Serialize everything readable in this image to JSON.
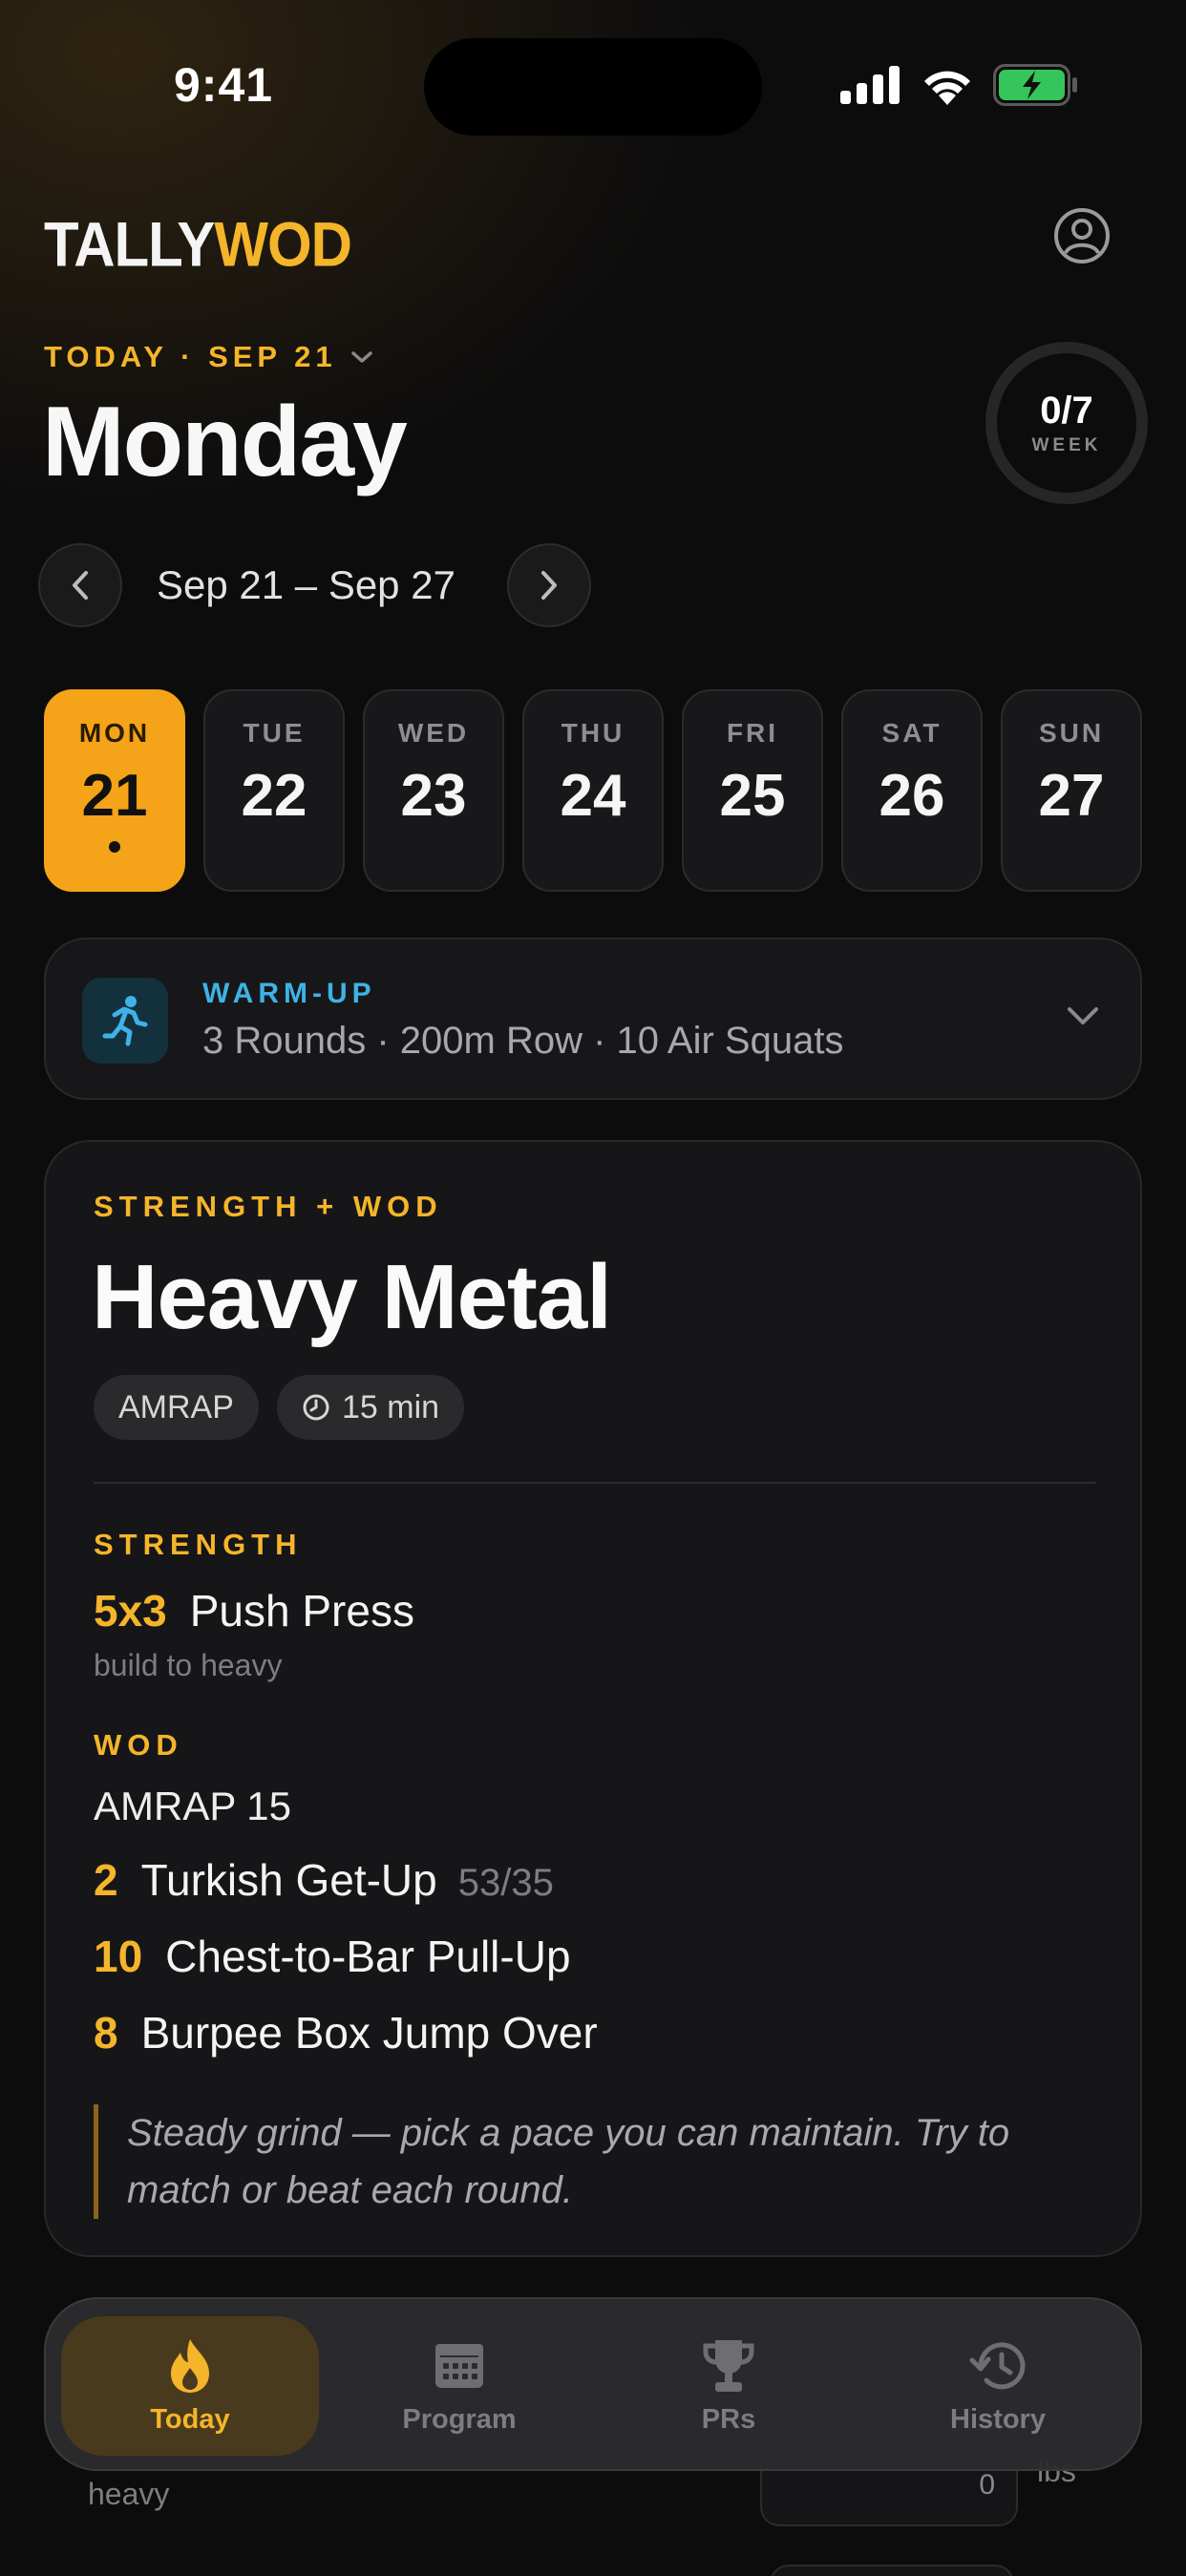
{
  "status_bar": {
    "time": "9:41"
  },
  "app": {
    "logo_part1": "TALLY",
    "logo_part2": "WOD"
  },
  "header": {
    "date_label": "TODAY · SEP 21",
    "day_title": "Monday",
    "week_progress": {
      "count": "0/7",
      "label": "WEEK",
      "completed": 0,
      "total": 7
    },
    "week_range": "Sep 21 – Sep 27"
  },
  "days": [
    {
      "name": "MON",
      "date": "21",
      "active": true,
      "has_workout": true
    },
    {
      "name": "TUE",
      "date": "22",
      "active": false
    },
    {
      "name": "WED",
      "date": "23",
      "active": false
    },
    {
      "name": "THU",
      "date": "24",
      "active": false
    },
    {
      "name": "FRI",
      "date": "25",
      "active": false
    },
    {
      "name": "SAT",
      "date": "26",
      "active": false
    },
    {
      "name": "SUN",
      "date": "27",
      "active": false
    }
  ],
  "warmup": {
    "tag": "WARM-UP",
    "description": "3 Rounds · 200m Row · 10 Air Squats",
    "icon": "running-person-icon"
  },
  "workout": {
    "category": "STRENGTH + WOD",
    "title": "Heavy Metal",
    "format": "AMRAP",
    "duration": "15 min",
    "strength": {
      "label": "STRENGTH",
      "scheme": "5x3",
      "movement": "Push Press",
      "note": "build to heavy"
    },
    "wod": {
      "label": "WOD",
      "heading": "AMRAP 15",
      "movements": [
        {
          "reps": "2",
          "name": "Turkish Get-Up",
          "load": "53/35"
        },
        {
          "reps": "10",
          "name": "Chest-to-Bar Pull-Up",
          "load": ""
        },
        {
          "reps": "8",
          "name": "Burpee Box Jump Over",
          "load": ""
        }
      ]
    },
    "coach_note": "Steady grind — pick a pace you can maintain. Try to match or beat each round."
  },
  "peek": {
    "note": "heavy",
    "unit": "lbs",
    "value": "0"
  },
  "tabs": [
    {
      "label": "Today",
      "icon": "flame-icon",
      "active": true
    },
    {
      "label": "Program",
      "icon": "calendar-icon",
      "active": false
    },
    {
      "label": "PRs",
      "icon": "trophy-icon",
      "active": false
    },
    {
      "label": "History",
      "icon": "history-icon",
      "active": false
    }
  ],
  "colors": {
    "accent": "#f5b52a",
    "active_day": "#f5a318",
    "warmup": "#3fb2e6",
    "background": "#0c0c0d",
    "card": "#161618"
  }
}
